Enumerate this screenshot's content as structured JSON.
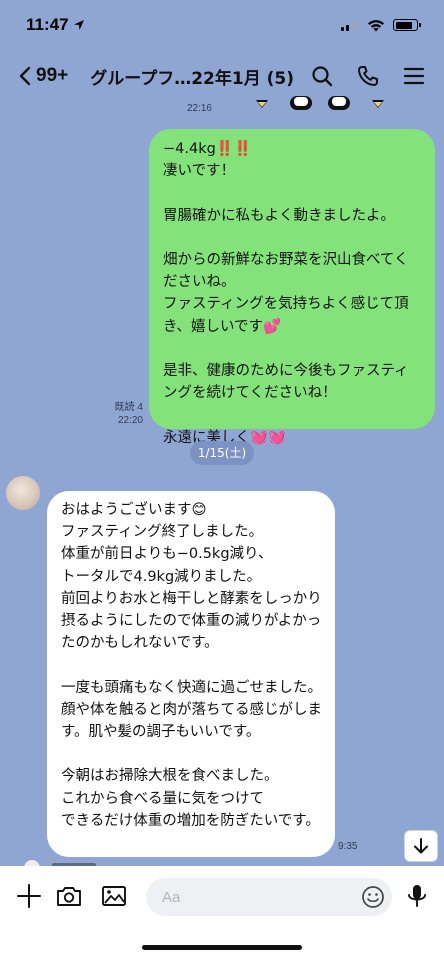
{
  "status_bar": {
    "time": "11:47"
  },
  "header": {
    "back_count": "99+",
    "title": "グループフ…22年1月 (5)"
  },
  "messages": [
    {
      "side": "right",
      "read_label": "既読 4",
      "time": "22:20",
      "text": "−4.4kg‼️‼️\n凄いです！\n\n胃腸確かに私もよく動きましたよ。\n\n畑からの新鮮なお野菜を沢山食べてくださいね。\nファスティングを気持ちよく感じて頂き、嬉しいです💕\n\n是非、健康のために今後もファスティングを続けてくださいね！\n\n永遠に美しく💓💓"
    },
    {
      "side": "left",
      "time": "9:35",
      "text": "おはようございます😊\nファスティング終了しました。\n体重が前日よりも−0.5kg減り、\nトータルで4.9kg減りました。\n前回よりお水と梅干しと酵素をしっかり摂るようにしたので体重の減りがよかったのかもしれないです。\n\n一度も頭痛もなく快適に過ごせました。\n顔や体を触ると肉が落ちてる感じがします。肌や髪の調子もいいです。\n\n今朝はお掃除大根を食べました。\nこれから食べる量に気をつけて\nできるだけ体重の増加を防ぎたいです。"
    }
  ],
  "previous_time": "22:16",
  "date_separator": "1/15(土)",
  "input": {
    "placeholder": "Aa"
  },
  "colors": {
    "background": "#8fa6d3",
    "own_bubble": "#84e27a",
    "other_bubble": "#ffffff",
    "date_pill": "#7d92c4"
  },
  "icons": {
    "header": [
      "search-icon",
      "phone-icon",
      "menu-icon"
    ],
    "input_bar": [
      "plus-icon",
      "camera-icon",
      "image-icon",
      "emoji-icon",
      "microphone-icon"
    ]
  }
}
